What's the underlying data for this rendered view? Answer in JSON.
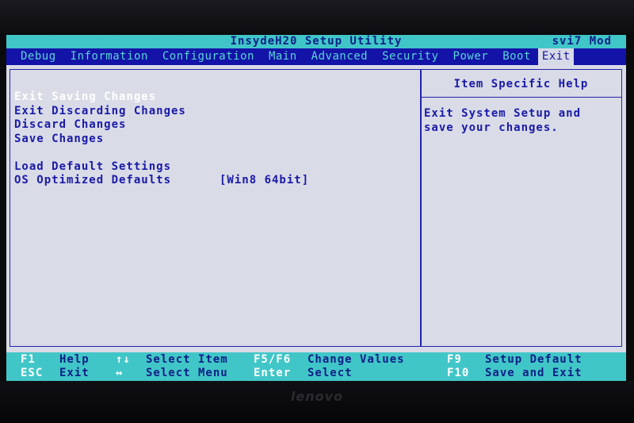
{
  "app": {
    "title": "InsydeH20 Setup Utility",
    "model": "svi7 Mod"
  },
  "menu": {
    "tabs": [
      {
        "label": "Debug"
      },
      {
        "label": "Information"
      },
      {
        "label": "Configuration"
      },
      {
        "label": "Main"
      },
      {
        "label": "Advanced"
      },
      {
        "label": "Security"
      },
      {
        "label": "Power"
      },
      {
        "label": "Boot"
      },
      {
        "label": "Exit"
      }
    ],
    "active": "Exit"
  },
  "exit_menu": {
    "items": [
      {
        "label": "Exit Saving Changes"
      },
      {
        "label": "Exit Discarding Changes"
      },
      {
        "label": "Discard Changes"
      },
      {
        "label": "Save Changes"
      },
      {
        "label": "Load Default Settings"
      },
      {
        "label": "OS Optimized Defaults",
        "value": "[Win8 64bit]"
      }
    ],
    "selected": "Exit Saving Changes"
  },
  "help": {
    "title": "Item Specific Help",
    "lines": [
      "Exit System Setup and",
      "save your changes."
    ]
  },
  "footer": {
    "row1": [
      {
        "key": "F1",
        "desc": "Help"
      },
      {
        "key": "↑↓",
        "desc": "Select Item"
      },
      {
        "key": "F5/F6",
        "desc": "Change Values"
      },
      {
        "key": "F9",
        "desc": "Setup Default"
      }
    ],
    "row2": [
      {
        "key": "ESC",
        "desc": "Exit"
      },
      {
        "key": "↔",
        "desc": "Select Menu"
      },
      {
        "key": "Enter",
        "desc": "Select"
      },
      {
        "key": "F10",
        "desc": "Save and Exit"
      }
    ]
  },
  "bezel": {
    "brand": "lenovo"
  },
  "colors": {
    "background": "#d9dbe7",
    "title_bar": "#41c6c8",
    "menu_bar": "#1313a8",
    "text": "#1a1aa6",
    "selected_text": "#ffffff"
  }
}
